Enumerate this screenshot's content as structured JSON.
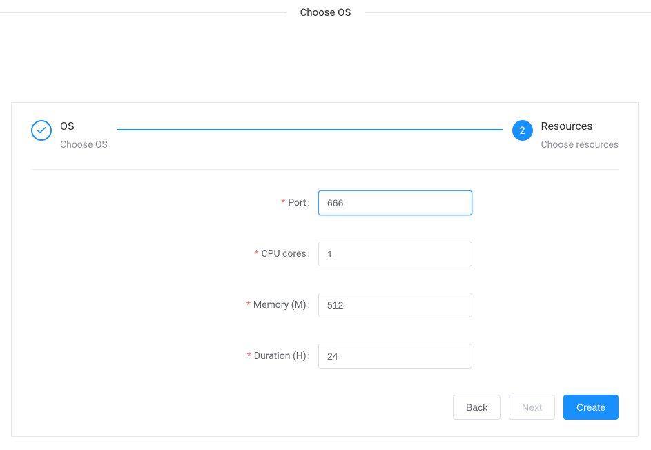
{
  "header": {
    "title": "Choose OS"
  },
  "steps": {
    "step1": {
      "title": "OS",
      "desc": "Choose OS"
    },
    "step2": {
      "number": "2",
      "title": "Resources",
      "desc": "Choose resources"
    }
  },
  "form": {
    "port": {
      "label": "Port",
      "value": "666"
    },
    "cpu": {
      "label": "CPU cores",
      "value": "1"
    },
    "memory": {
      "label": "Memory (M)",
      "value": "512"
    },
    "duration": {
      "label": "Duration (H)",
      "value": "24"
    }
  },
  "buttons": {
    "back": "Back",
    "next": "Next",
    "create": "Create"
  }
}
